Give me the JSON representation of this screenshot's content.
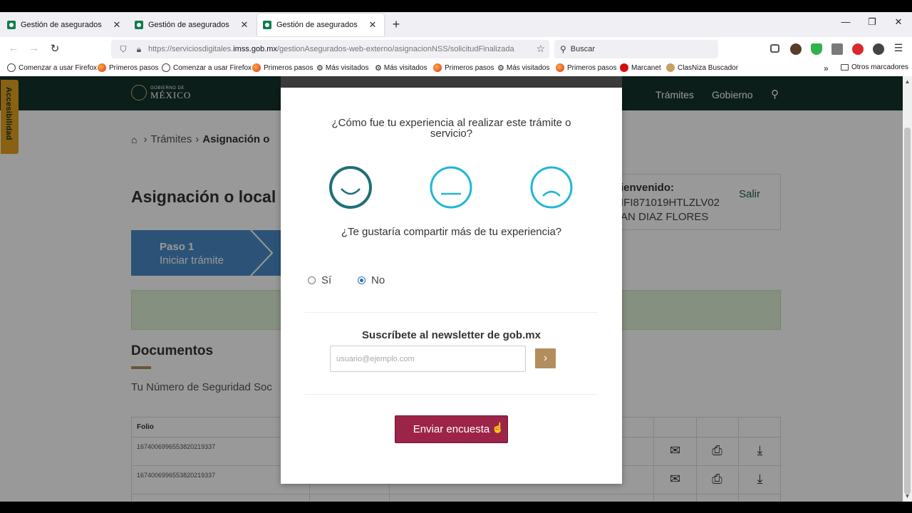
{
  "browser": {
    "tabs": [
      {
        "label": "Gestión de asegurados",
        "close": "✕"
      },
      {
        "label": "Gestión de asegurados",
        "close": "✕"
      },
      {
        "label": "Gestión de asegurados",
        "close": "✕"
      }
    ],
    "new_tab": "+",
    "window_controls": {
      "minimize": "—",
      "restore": "❐",
      "close": "✕"
    },
    "nav": {
      "back": "←",
      "forward": "→",
      "reload": "↻"
    },
    "url": {
      "prefix": "https://serviciosdigitales.",
      "host": "imss.gob.mx",
      "path": "/gestionAsegurados-web-externo/asignacionNSS/solicitudFinalizada"
    },
    "search_placeholder": "Buscar",
    "bookmarks": [
      {
        "label": "Comenzar a usar Firefox",
        "icon": "globe"
      },
      {
        "label": "Primeros pasos",
        "icon": "fox"
      },
      {
        "label": "Comenzar a usar Firefox",
        "icon": "globe"
      },
      {
        "label": "Primeros pasos",
        "icon": "fox"
      },
      {
        "label": "Más visitados",
        "icon": "gear"
      },
      {
        "label": "Más visitados",
        "icon": "gear"
      },
      {
        "label": "Primeros pasos",
        "icon": "fox"
      },
      {
        "label": "Más visitados",
        "icon": "gear"
      },
      {
        "label": "Primeros pasos",
        "icon": "fox"
      },
      {
        "label": "Marcanet",
        "icon": "red"
      },
      {
        "label": "ClasNiza Buscador",
        "icon": "tan"
      }
    ],
    "other_bookmarks": "Otros marcadores",
    "overflow": "»"
  },
  "site": {
    "logo_small": "GOBIERNO DE",
    "logo_big": "MÉXICO",
    "nav": [
      "Trámites",
      "Gobierno"
    ],
    "accessibility": "Accesibilidad",
    "breadcrumb": {
      "item1": "Trámites",
      "item2": "Asignación o"
    },
    "page_title": "Asignación o local",
    "user": {
      "welcome": "ienvenido:",
      "curp": "IFI871019HTLZLV02",
      "name": "AN DIAZ FLORES",
      "logout": "Salir"
    },
    "step": {
      "title": "Paso 1",
      "subtitle": "Iniciar trámite"
    },
    "documents_title": "Documentos",
    "documents_text": "Tu Número de Seguridad Soc",
    "table": {
      "header": "Folio",
      "rows": [
        "1674006996553820219337",
        "1674006996553820219337"
      ]
    }
  },
  "modal": {
    "question1": "¿Cómo fue tu experiencia al realizar este trámite o servicio?",
    "faces": [
      "happy-face-icon",
      "neutral-face-icon",
      "sad-face-icon"
    ],
    "question2": "¿Te gustaría compartir más de tu experiencia?",
    "options": {
      "yes": "Sí",
      "no": "No",
      "selected": "No"
    },
    "newsletter_title": "Suscríbete al newsletter de gob.mx",
    "email_placeholder": "usuario@ejemplo.com",
    "go_button": "›",
    "submit": "Enviar encuesta"
  },
  "colors": {
    "gob_green": "#13322b",
    "gold": "#b38e5d",
    "submit": "#9d2449",
    "face_happy": "#1e6f78",
    "face_other": "#22b6d4",
    "step_blue": "#4a8bc6"
  }
}
